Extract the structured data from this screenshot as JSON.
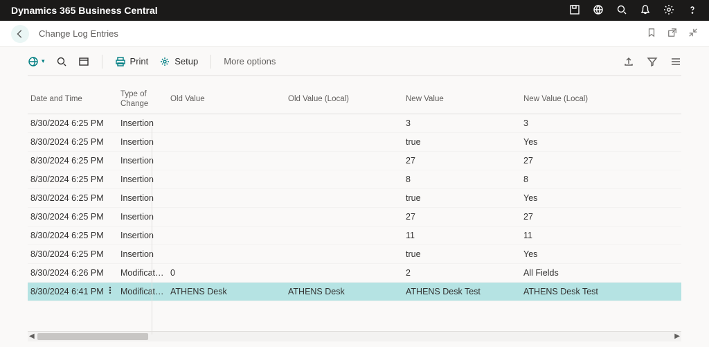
{
  "brand": "Dynamics 365 Business Central",
  "page_title": "Change Log Entries",
  "commands": {
    "print": "Print",
    "setup": "Setup",
    "more_options": "More options"
  },
  "columns": {
    "c0": "Date and Time",
    "c1": "Type of Change",
    "c2": "Old Value",
    "c3": "Old Value (Local)",
    "c4": "New Value",
    "c5": "New Value (Local)"
  },
  "rows": [
    {
      "dt": "8/30/2024 6:25 PM",
      "type": "Insertion",
      "old": "",
      "oldl": "",
      "new": "3",
      "newl": "3",
      "selected": false
    },
    {
      "dt": "8/30/2024 6:25 PM",
      "type": "Insertion",
      "old": "",
      "oldl": "",
      "new": "true",
      "newl": "Yes",
      "selected": false
    },
    {
      "dt": "8/30/2024 6:25 PM",
      "type": "Insertion",
      "old": "",
      "oldl": "",
      "new": "27",
      "newl": "27",
      "selected": false
    },
    {
      "dt": "8/30/2024 6:25 PM",
      "type": "Insertion",
      "old": "",
      "oldl": "",
      "new": "8",
      "newl": "8",
      "selected": false
    },
    {
      "dt": "8/30/2024 6:25 PM",
      "type": "Insertion",
      "old": "",
      "oldl": "",
      "new": "true",
      "newl": "Yes",
      "selected": false
    },
    {
      "dt": "8/30/2024 6:25 PM",
      "type": "Insertion",
      "old": "",
      "oldl": "",
      "new": "27",
      "newl": "27",
      "selected": false
    },
    {
      "dt": "8/30/2024 6:25 PM",
      "type": "Insertion",
      "old": "",
      "oldl": "",
      "new": "11",
      "newl": "11",
      "selected": false
    },
    {
      "dt": "8/30/2024 6:25 PM",
      "type": "Insertion",
      "old": "",
      "oldl": "",
      "new": "true",
      "newl": "Yes",
      "selected": false
    },
    {
      "dt": "8/30/2024 6:26 PM",
      "type": "Modification",
      "old": "0",
      "oldl": "",
      "new": "2",
      "newl": "All Fields",
      "selected": false
    },
    {
      "dt": "8/30/2024 6:41 PM",
      "type": "Modification",
      "old": "ATHENS Desk",
      "oldl": "ATHENS Desk",
      "new": "ATHENS Desk Test",
      "newl": "ATHENS Desk Test",
      "selected": true
    }
  ]
}
